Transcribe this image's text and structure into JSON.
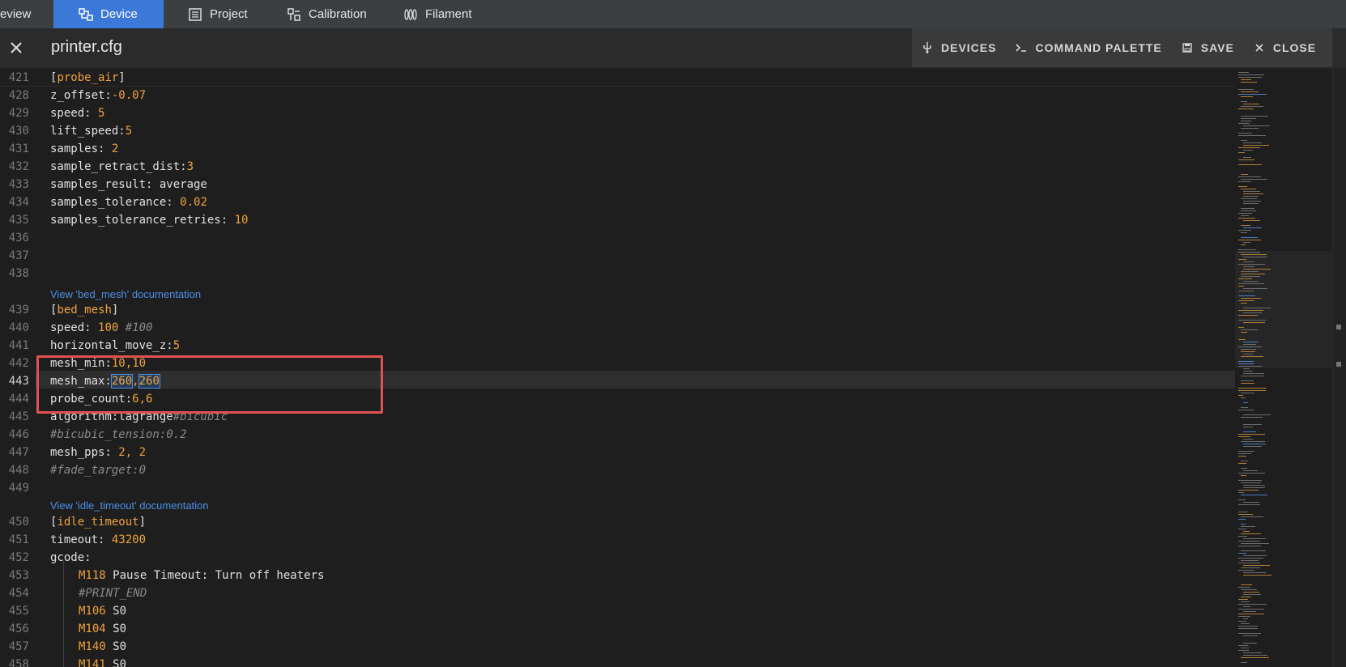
{
  "nav": {
    "preview_label": "eview",
    "device_label": "Device",
    "project_label": "Project",
    "calibration_label": "Calibration",
    "filament_label": "Filament"
  },
  "header": {
    "file_name": "printer.cfg",
    "devices_label": "DEVICES",
    "command_palette_label": "COMMAND PALETTE",
    "save_label": "SAVE",
    "close_label": "CLOSE"
  },
  "editor": {
    "sticky_line_no": "421",
    "sticky_section": "probe_air",
    "doc_links": {
      "bed_mesh": "View 'bed_mesh' documentation",
      "idle_timeout": "View 'idle_timeout' documentation"
    },
    "lines": {
      "l428": {
        "no": "428",
        "key": "z_offset:",
        "val": "-0.07"
      },
      "l429": {
        "no": "429",
        "key": "speed: ",
        "val": "5"
      },
      "l430": {
        "no": "430",
        "key": "lift_speed:",
        "val": "5"
      },
      "l431": {
        "no": "431",
        "key": "samples: ",
        "val": "2"
      },
      "l432": {
        "no": "432",
        "key": "sample_retract_dist:",
        "val": "3"
      },
      "l433": {
        "no": "433",
        "key": "samples_result: average"
      },
      "l434": {
        "no": "434",
        "key": "samples_tolerance: ",
        "val": "0.02"
      },
      "l435": {
        "no": "435",
        "key": "samples_tolerance_retries: ",
        "val": "10"
      },
      "l436": {
        "no": "436"
      },
      "l437": {
        "no": "437"
      },
      "l438": {
        "no": "438"
      },
      "l439": {
        "no": "439",
        "section": "bed_mesh"
      },
      "l440": {
        "no": "440",
        "key": "speed: ",
        "val": "100",
        "comment": "#100"
      },
      "l441": {
        "no": "441",
        "key": "horizontal_move_z:",
        "val": "5"
      },
      "l442": {
        "no": "442",
        "key": "mesh_min:",
        "val": "10,10"
      },
      "l443": {
        "no": "443",
        "key": "mesh_max:",
        "val1": "260",
        "sep": ",",
        "val2": "260"
      },
      "l444": {
        "no": "444",
        "key": "probe_count:",
        "val": "6,6"
      },
      "l445": {
        "no": "445",
        "key": "algorithm:lagrange",
        "comment": "#bicubic"
      },
      "l446": {
        "no": "446",
        "comment": "#bicubic_tension:0.2"
      },
      "l447": {
        "no": "447",
        "key": "mesh_pps: ",
        "val": "2, 2"
      },
      "l448": {
        "no": "448",
        "comment": "#fade_target:0"
      },
      "l449": {
        "no": "449"
      },
      "l450": {
        "no": "450",
        "section": "idle_timeout"
      },
      "l451": {
        "no": "451",
        "key": "timeout: ",
        "val": "43200"
      },
      "l452": {
        "no": "452",
        "key": "gcode:"
      },
      "l453": {
        "no": "453",
        "cmd": "M118",
        "rest": " Pause Timeout: Turn off heaters"
      },
      "l454": {
        "no": "454",
        "comment": "#PRINT_END"
      },
      "l455": {
        "no": "455",
        "cmd": "M106",
        "rest": " S0"
      },
      "l456": {
        "no": "456",
        "cmd": "M104",
        "rest": " S0"
      },
      "l457": {
        "no": "457",
        "cmd": "M140",
        "rest": " S0"
      },
      "l458": {
        "no": "458",
        "cmd": "M141",
        "rest": " S0"
      }
    }
  },
  "colors": {
    "accent": "#3c78d8",
    "number": "#f0a33c",
    "link": "#4d8fe8",
    "highlight_box": "#e05252"
  }
}
